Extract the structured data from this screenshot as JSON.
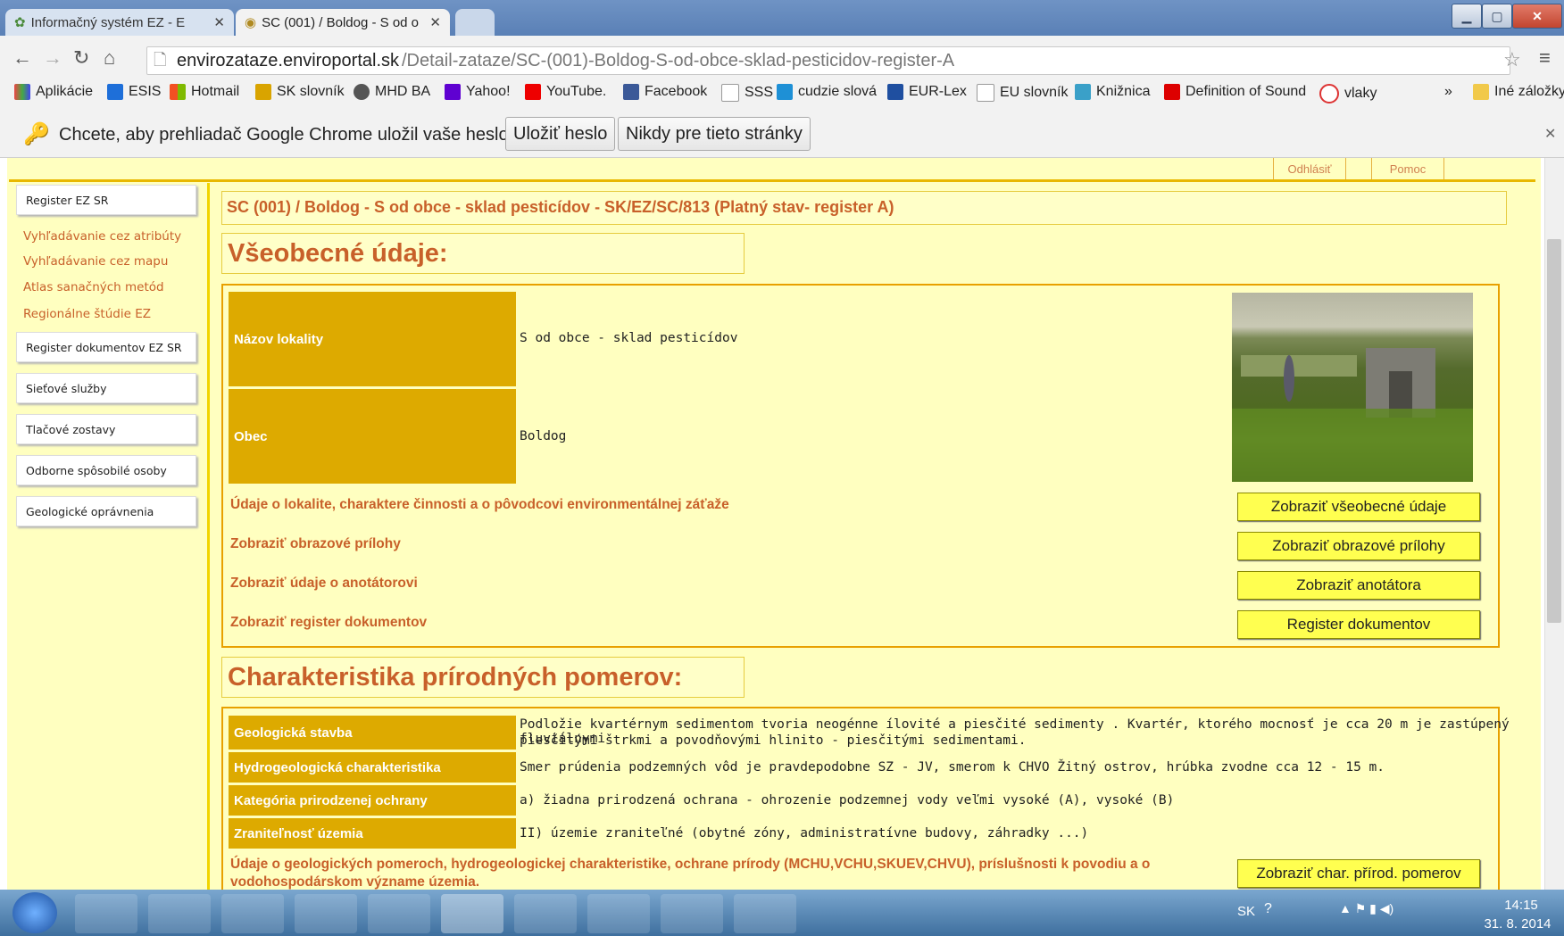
{
  "browser": {
    "tabs": [
      {
        "title": "Informačný systém EZ - E"
      },
      {
        "title": "SC (001) / Boldog - S od o"
      }
    ],
    "url_host": "envirozataze.enviroportal.sk",
    "url_path": "/Detail-zataze/SC-(001)-Boldog-S-od-obce-sklad-pesticidov-register-A",
    "bookmarks": [
      "Aplikácie",
      "ESIS",
      "Hotmail",
      "SK slovník",
      "MHD BA",
      "Yahoo!",
      "YouTube.",
      "Facebook",
      "SSS",
      "cudzie slová",
      "EUR-Lex",
      "EU slovník",
      "Knižnica",
      "Definition of Sound",
      "vlaky"
    ],
    "bookmarks_more": "»",
    "other_bookmarks": "Iné záložky",
    "infobar": {
      "text": "Chcete, aby prehliadač Google Chrome uložil vaše heslo?",
      "save": "Uložiť heslo",
      "never": "Nikdy pre tieto stránky"
    }
  },
  "site": {
    "top_links": {
      "logout": "Odhlásiť",
      "help": "Pomoc"
    },
    "sidebar": {
      "box1": "Register EZ SR",
      "links": [
        "Vyhľadávanie cez atribúty",
        "Vyhľadávanie cez mapu",
        "Atlas sanačných metód",
        "Regionálne štúdie EZ"
      ],
      "boxes": [
        "Register dokumentov EZ SR",
        "Sieťové služby",
        "Tlačové zostavy",
        "Odborne spôsobilé osoby",
        "Geologické oprávnenia"
      ]
    },
    "header": "SC (001) / Boldog - S od obce - sklad pesticídov - SK/EZ/SC/813 (Platný stav- register A)",
    "general": {
      "title": "Všeobecné údaje:",
      "rows": [
        {
          "label": "Názov lokality",
          "value": "S od obce - sklad pesticídov"
        },
        {
          "label": "Obec",
          "value": "Boldog"
        }
      ],
      "links": [
        {
          "text": "Údaje o lokalite, charaktere činnosti a o pôvodcovi environmentálnej záťaže",
          "button": "Zobraziť všeobecné údaje"
        },
        {
          "text": "Zobraziť obrazové prílohy",
          "button": "Zobraziť obrazové prílohy"
        },
        {
          "text": "Zobraziť údaje o anotátorovi",
          "button": "Zobraziť anotátora"
        },
        {
          "text": "Zobraziť register dokumentov",
          "button": "Register dokumentov"
        }
      ]
    },
    "nature": {
      "title": "Charakteristika prírodných pomerov:",
      "rows": [
        {
          "label": "Geologická stavba",
          "value1": "Podložie kvartérnym sedimentom tvoria neogénne ílovité a piesčité sedimenty . Kvartér, ktorého mocnosť je cca 20 m je zastúpený fluviálnymi",
          "value2": "piesčitými štrkmi a povodňovými hlinito - piesčitými sedimentami."
        },
        {
          "label": "Hydrogeologická charakteristika",
          "value1": "Smer prúdenia podzemných vôd je pravdepodobne SZ - JV, smerom k CHVO Žitný ostrov, hrúbka zvodne cca 12 - 15 m."
        },
        {
          "label": "Kategória prirodzenej ochrany",
          "value1": "a) žiadna prirodzená ochrana - ohrozenie podzemnej vody veľmi vysoké (A), vysoké (B)"
        },
        {
          "label": "Zraniteľnosť územia",
          "value1": "II) územie zraniteľné (obytné zóny, administratívne budovy, záhradky ...)"
        }
      ],
      "link_text1": "Údaje o geologických pomeroch, hydrogeologickej charakteristike, ochrane prírody (MCHU,VCHU,SKUEV,CHVU), príslušnosti k povodiu a o",
      "link_text2": "vodohospodárskom význame územia.",
      "button": "Zobraziť char. přírod. pomerov"
    }
  },
  "taskbar": {
    "lang": "SK",
    "time": "14:15",
    "date": "31. 8. 2014"
  }
}
